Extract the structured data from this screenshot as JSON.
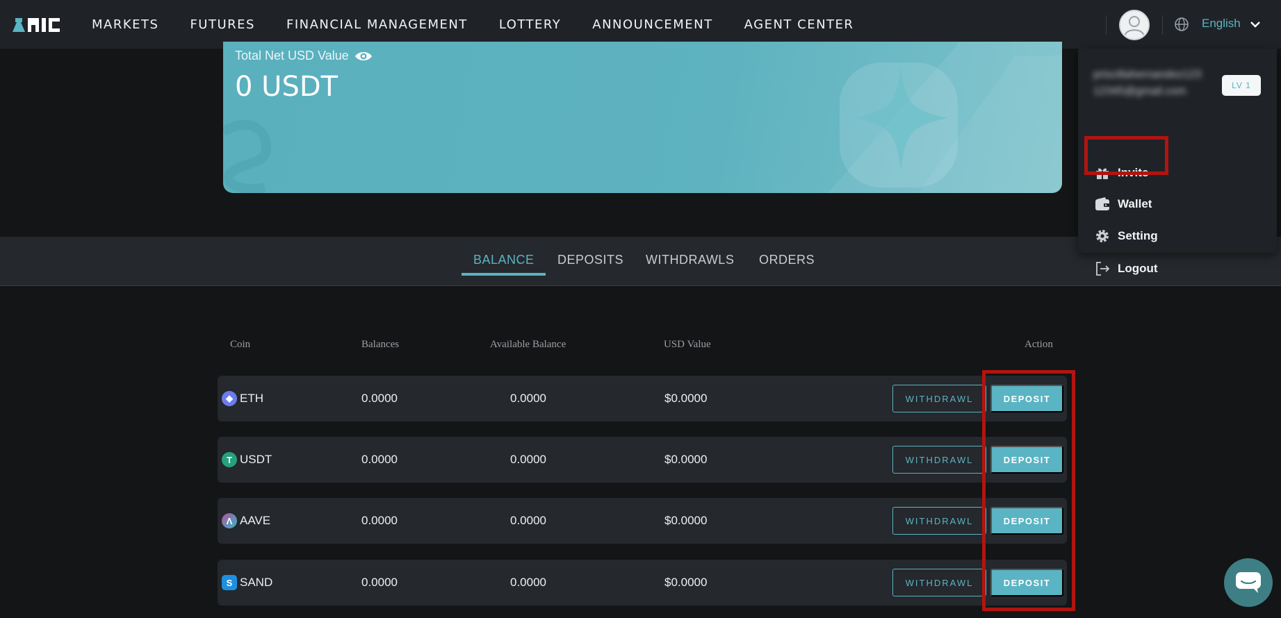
{
  "nav": {
    "logo_alt": "AIC",
    "items": [
      "MARKETS",
      "FUTURES",
      "FINANCIAL MANAGEMENT",
      "LOTTERY",
      "ANNOUNCEMENT",
      "AGENT CENTER"
    ],
    "language": "English"
  },
  "hero": {
    "title": "Total Net USD Value",
    "value": "0 USDT"
  },
  "user_menu": {
    "email_line1": "priscillahernandez123",
    "email_line2": "12345@gmail.com",
    "level": "LV 1",
    "items": [
      {
        "label": "Invite",
        "icon": "gift-icon"
      },
      {
        "label": "Wallet",
        "icon": "wallet-icon"
      },
      {
        "label": "Setting",
        "icon": "gear-icon"
      },
      {
        "label": "Logout",
        "icon": "logout-icon"
      }
    ]
  },
  "tabs": [
    "BALANCE",
    "DEPOSITS",
    "WITHDRAWLS",
    "ORDERS"
  ],
  "table": {
    "headers": {
      "coin": "Coin",
      "balances": "Balances",
      "available": "Available Balance",
      "usd": "USD Value",
      "action": "Action"
    },
    "rows": [
      {
        "coin": "ETH",
        "balance": "0.0000",
        "available": "0.0000",
        "usd": "$0.0000",
        "icon": "ethereum-icon",
        "icon_color": "#6b7cf0"
      },
      {
        "coin": "USDT",
        "balance": "0.0000",
        "available": "0.0000",
        "usd": "$0.0000",
        "icon": "tether-icon",
        "icon_color": "#26a17b"
      },
      {
        "coin": "AAVE",
        "balance": "0.0000",
        "available": "0.0000",
        "usd": "$0.0000",
        "icon": "aave-icon",
        "icon_color": "#8a6cc8"
      },
      {
        "coin": "SAND",
        "balance": "0.0000",
        "available": "0.0000",
        "usd": "$0.0000",
        "icon": "sandbox-icon",
        "icon_color": "#1f8fe0"
      }
    ],
    "withdraw_label": "WITHDRAWL",
    "deposit_label": "DEPOSIT"
  },
  "colors": {
    "accent": "#5ab4c4",
    "highlight": "#b21410",
    "background": "#141516"
  }
}
